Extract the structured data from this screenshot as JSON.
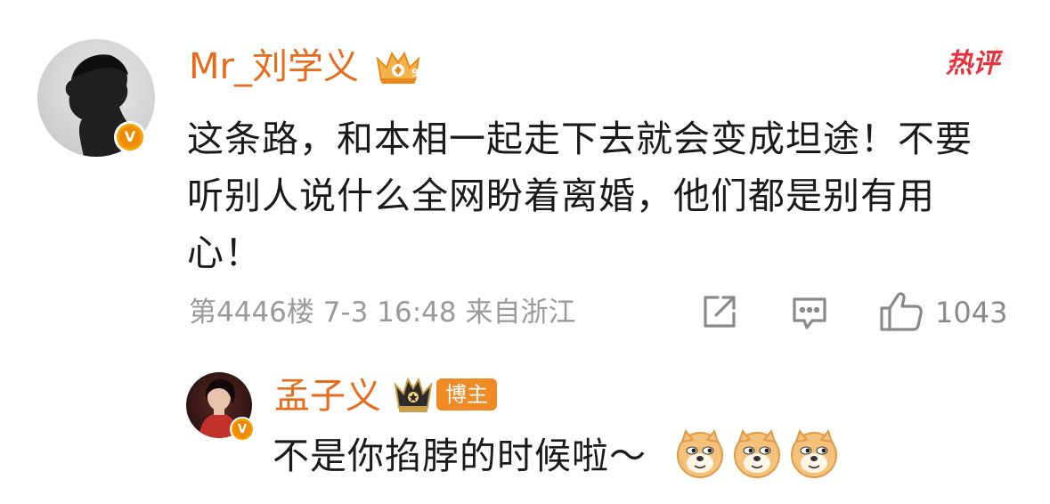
{
  "comment": {
    "user_name": "Mr_刘学义",
    "avatar_icon": "user-avatar-silhouette",
    "verified_icon": "verified-v-badge",
    "verified_glyph": "V",
    "crown_icon": "fan-crown-badge",
    "hot_label": "热评",
    "text": "这条路，和本相一起走下去就会变成坦途！不要听别人说什么全网盼着离婚，他们都是别有用心！",
    "floor": "第4446楼",
    "date": "7-3 16:48",
    "location": "来自浙江",
    "share_icon": "share-icon",
    "comment_icon": "comment-icon",
    "like_icon": "thumbs-up-icon",
    "like_count": "1043"
  },
  "reply": {
    "user_name": "孟子义",
    "avatar_icon": "user-avatar-photo",
    "verified_icon": "verified-v-badge",
    "verified_glyph": "V",
    "crown_icon": "crown-badge",
    "blogger_label": "博主",
    "text": "不是你掐脖的时候啦～",
    "emojis": [
      "doge-emoji",
      "doge-emoji",
      "doge-emoji"
    ]
  },
  "colors": {
    "name_orange": "#e86b1c",
    "meta_gray": "#9a9a9a",
    "badge_orange": "#f08a24",
    "hot_red": "#e6323c",
    "verified_yellow": "#f5a300"
  }
}
